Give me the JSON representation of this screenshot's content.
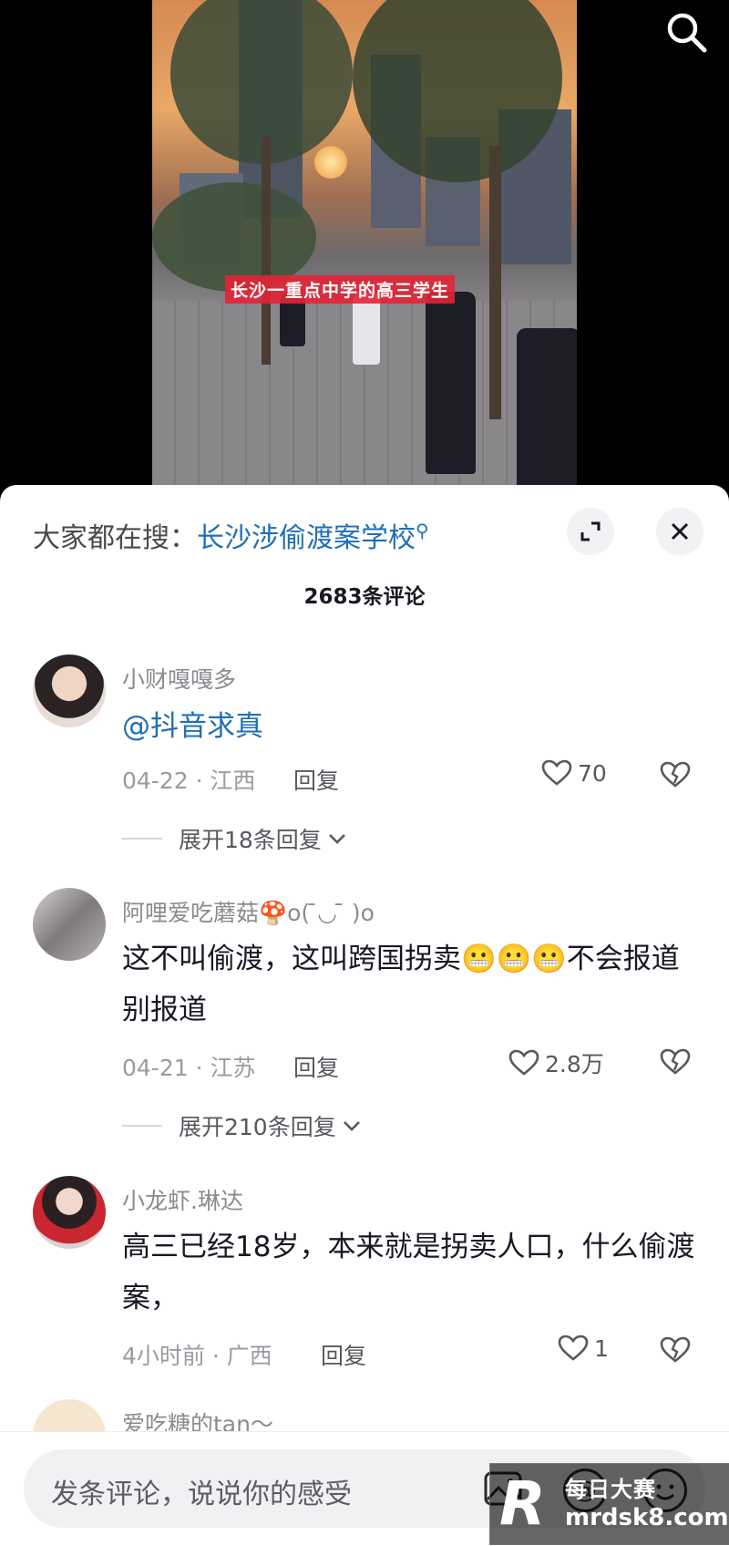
{
  "video": {
    "caption": "长沙一重点中学的高三学生"
  },
  "suggest": {
    "prefix": "大家都在搜：",
    "keyword": "长沙涉偷渡案学校"
  },
  "comment_count": "2683条评论",
  "comments": [
    {
      "name": "小财嘎嘎多",
      "mention": "@抖音求真",
      "date_loc": "04-22 · 江西",
      "reply": "回复",
      "likes": "70",
      "expand": "展开18条回复"
    },
    {
      "name": "阿哩爱吃蘑菇🍄o(  ̄◡ ̄ )o",
      "text": "这不叫偷渡，这叫跨国拐卖😬😬😬不会报道别报道",
      "date_loc": "04-21 · 江苏",
      "reply": "回复",
      "likes": "2.8万",
      "expand": "展开210条回复"
    },
    {
      "name": "小龙虾.琳达",
      "text": "高三已经18岁，本来就是拐卖人口，什么偷渡案，",
      "date_loc": "4小时前 · 广西",
      "reply": "回复",
      "likes": "1"
    },
    {
      "name": "爱吃糖的tan～"
    }
  ],
  "composer": {
    "placeholder": "发条评论，说说你的感受"
  },
  "watermark": {
    "brand": "每日大赛",
    "url": "mrdsk8.com"
  },
  "colors": {
    "link": "#1f6fb7",
    "caption_bg": "#e32335"
  }
}
